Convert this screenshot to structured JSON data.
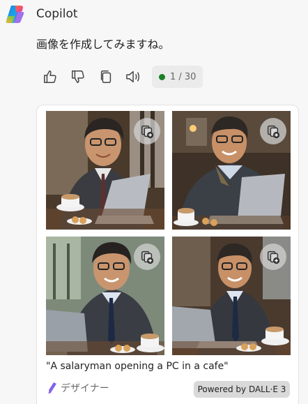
{
  "header": {
    "app_name": "Copilot",
    "logo_icon": "copilot-logo-icon"
  },
  "message": {
    "text": "画像を作成してみますね。"
  },
  "actions": {
    "items": [
      {
        "icon": "thumbs-up-icon"
      },
      {
        "icon": "thumbs-down-icon"
      },
      {
        "icon": "copy-icon"
      },
      {
        "icon": "speaker-icon"
      }
    ],
    "counter": "1 / 30",
    "status_color": "#1b7f25"
  },
  "card": {
    "images": [
      {
        "alt": "man in glasses smiling at laptop with coffee, image 1"
      },
      {
        "alt": "man in glasses smiling at laptop with coffee, image 2"
      },
      {
        "alt": "man in glasses smiling at laptop with coffee, image 3"
      },
      {
        "alt": "man in glasses smiling at laptop with coffee, image 4"
      }
    ],
    "save_icon": "save-to-collection-icon",
    "caption": "\"A salaryman opening a PC in a cafe\"",
    "designer_label": "デザイナー",
    "powered_label": "Powered by DALL·E 3"
  }
}
